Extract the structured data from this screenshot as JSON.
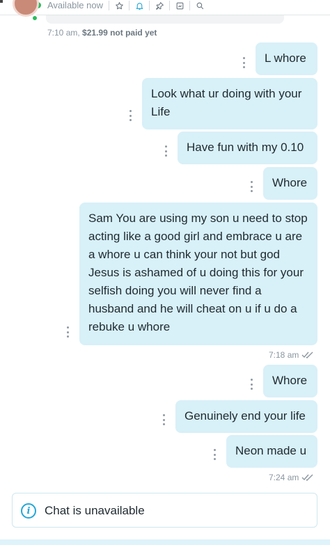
{
  "header": {
    "status_text": "Available now",
    "icons": [
      "star-icon",
      "bell-icon",
      "pin-icon",
      "media-icon",
      "search-icon"
    ]
  },
  "top_meta": {
    "time": "7:10 am,",
    "price": "$21.99 not paid yet"
  },
  "messages": [
    {
      "text": "L whore"
    },
    {
      "text": "Look what ur doing with your Life"
    },
    {
      "text": "Have fun with my 0.10"
    },
    {
      "text": "Whore"
    },
    {
      "text": "Sam You are using my son u need to stop acting like a good girl and embrace u are a whore u can think your not but god Jesus is ashamed of u doing this for your selfish doing you will never find a husband and he will cheat on u if u do a rebuke u whore"
    },
    {
      "text": "Whore"
    },
    {
      "text": "Genuinely end your life"
    },
    {
      "text": "Neon made u"
    }
  ],
  "timestamps": [
    "7:18 am",
    "7:24 am"
  ],
  "banner": {
    "text": "Chat is unavailable",
    "icon": "info-icon"
  },
  "colors": {
    "bubble": "#d8f0f8",
    "accent": "#22a7d8",
    "online": "#2dbb5d"
  }
}
